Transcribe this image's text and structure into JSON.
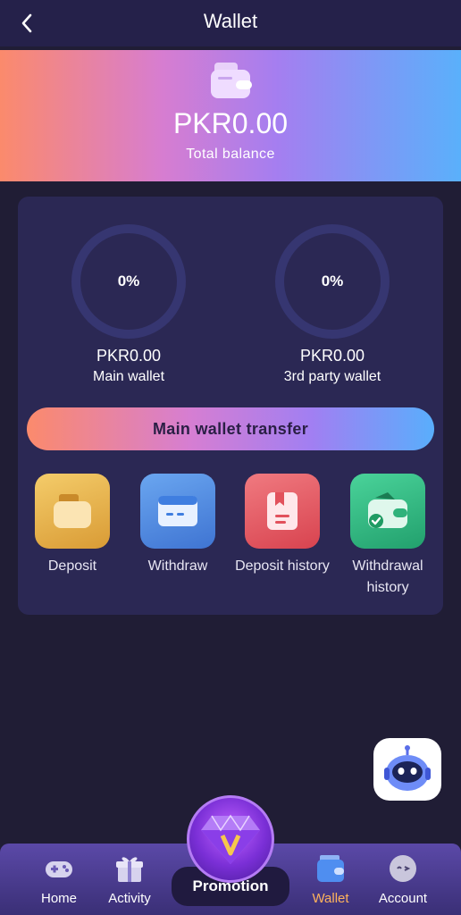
{
  "header": {
    "title": "Wallet"
  },
  "banner": {
    "total_amount": "PKR0.00",
    "total_label": "Total balance"
  },
  "wallets": [
    {
      "percent": "0%",
      "amount": "PKR0.00",
      "label": "Main wallet"
    },
    {
      "percent": "0%",
      "amount": "PKR0.00",
      "label": "3rd party wallet"
    }
  ],
  "transfer_button": "Main wallet transfer",
  "actions": [
    {
      "label": "Deposit",
      "icon": "deposit-wallet-icon",
      "color": "#e9b84e"
    },
    {
      "label": "Withdraw",
      "icon": "card-icon",
      "color": "#5a93e6"
    },
    {
      "label": "Deposit history",
      "icon": "receipt-icon",
      "color": "#e85f6a"
    },
    {
      "label": "Withdrawal history",
      "icon": "wallet-check-icon",
      "color": "#3cc08a"
    }
  ],
  "nav": {
    "items": [
      {
        "label": "Home",
        "icon": "gamepad-icon"
      },
      {
        "label": "Activity",
        "icon": "gift-icon"
      },
      {
        "label": "Promotion",
        "icon": "diamond-icon"
      },
      {
        "label": "Wallet",
        "icon": "wallet-icon",
        "active": true
      },
      {
        "label": "Account",
        "icon": "avatar-icon"
      }
    ]
  },
  "colors": {
    "background": "#201d35",
    "card": "#2b2854",
    "active_nav": "#ffb35c"
  }
}
